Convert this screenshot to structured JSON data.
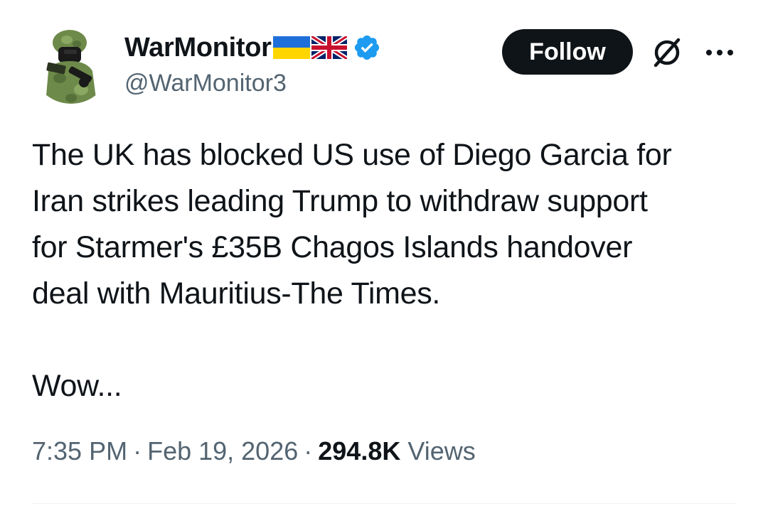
{
  "author": {
    "display_name": "WarMonitor",
    "handle": "@WarMonitor3",
    "flags": [
      "ukraine-flag-icon",
      "uk-flag-icon"
    ],
    "verified": true,
    "verified_color": "#1d9bf0"
  },
  "actions": {
    "follow_label": "Follow",
    "grok_icon": "grok-icon",
    "more_icon": "more-icon"
  },
  "tweet": {
    "lines": [
      "The UK has blocked US use of Diego Garcia for",
      "Iran strikes leading Trump to withdraw support",
      "for Starmer's £35B Chagos Islands handover",
      "deal with Mauritius-The Times."
    ],
    "closing": "Wow..."
  },
  "meta": {
    "time": "7:35 PM",
    "separator": "·",
    "date": "Feb 19, 2026",
    "views_count": "294.8K",
    "views_label": "Views"
  },
  "colors": {
    "text": "#0f1419",
    "muted": "#536471",
    "follow_bg": "#0f1419",
    "divider": "#eff3f4"
  }
}
